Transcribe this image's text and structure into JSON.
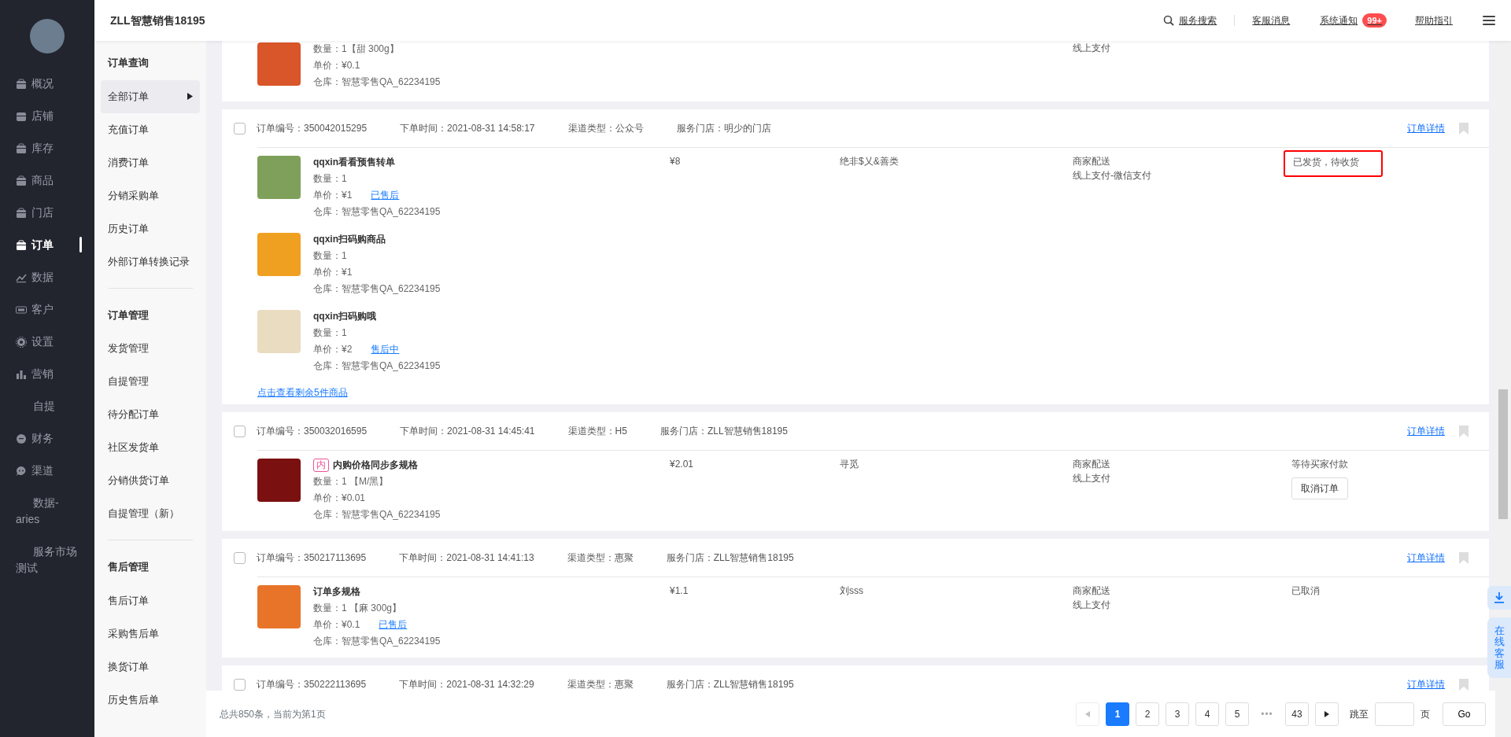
{
  "sidebar": {
    "items": [
      {
        "label": "概况",
        "has_icon": true,
        "selected": false
      },
      {
        "label": "店铺",
        "has_icon": true,
        "selected": false
      },
      {
        "label": "库存",
        "has_icon": true,
        "selected": false
      },
      {
        "label": "商品",
        "has_icon": true,
        "selected": false
      },
      {
        "label": "门店",
        "has_icon": true,
        "selected": false
      },
      {
        "label": "订单",
        "has_icon": true,
        "selected": true
      },
      {
        "label": "数据",
        "has_icon": true,
        "selected": false
      },
      {
        "label": "客户",
        "has_icon": true,
        "selected": false
      },
      {
        "label": "设置",
        "has_icon": true,
        "selected": false
      },
      {
        "label": "营销",
        "has_icon": true,
        "selected": false
      },
      {
        "label": "自提",
        "has_icon": false,
        "selected": false
      },
      {
        "label": "财务",
        "has_icon": true,
        "selected": false
      },
      {
        "label": "渠道",
        "has_icon": true,
        "selected": false
      },
      {
        "label": "数据-aries",
        "has_icon": false,
        "selected": false
      },
      {
        "label": "服务市场测试",
        "has_icon": false,
        "selected": false
      }
    ]
  },
  "header": {
    "title": "ZLL智慧销售18195",
    "search": "服务搜索",
    "service_messages": "客服消息",
    "notifications": {
      "label": "系统通知",
      "badge": "99+"
    },
    "help": "帮助指引"
  },
  "subnav": {
    "groups": [
      {
        "heading": "订单查询",
        "items": [
          {
            "label": "全部订单",
            "selected": true
          },
          {
            "label": "充值订单",
            "selected": false
          },
          {
            "label": "消费订单",
            "selected": false
          },
          {
            "label": "分销采购单",
            "selected": false
          },
          {
            "label": "历史订单",
            "selected": false
          },
          {
            "label": "外部订单转换记录",
            "selected": false
          }
        ]
      },
      {
        "heading": "订单管理",
        "items": [
          {
            "label": "发货管理",
            "selected": false
          },
          {
            "label": "自提管理",
            "selected": false
          },
          {
            "label": "待分配订单",
            "selected": false
          },
          {
            "label": "社区发货单",
            "selected": false
          },
          {
            "label": "分销供货订单",
            "selected": false
          },
          {
            "label": "自提管理（新）",
            "selected": false
          }
        ]
      },
      {
        "heading": "售后管理",
        "items": [
          {
            "label": "售后订单",
            "selected": false
          },
          {
            "label": "采购售后单",
            "selected": false
          },
          {
            "label": "换货订单",
            "selected": false
          },
          {
            "label": "历史售后单",
            "selected": false
          }
        ]
      }
    ]
  },
  "orders": [
    {
      "partial": true,
      "products": [
        {
          "qty": "数量：1【甜 300g】",
          "unit_price": "单价：¥0.1",
          "warehouse": "仓库：智慧零售QA_62234195"
        }
      ],
      "delivery": [
        "线上支付"
      ]
    },
    {
      "checked": false,
      "number": "订单编号：350042015295",
      "time": "下单时间：2021-08-31 14:58:17",
      "channel": "渠道类型：公众号",
      "store": "服务门店：明少的门店",
      "detail": "订单详情",
      "products": [
        {
          "name": "qqxin看看预售转单",
          "qty": "数量：1",
          "unit_price": "单价：¥1",
          "after_sale": "已售后",
          "warehouse": "仓库：智慧零售QA_62234195"
        },
        {
          "name": "qqxin扫码购商品",
          "qty": "数量：1",
          "unit_price": "单价：¥1",
          "warehouse": "仓库：智慧零售QA_62234195"
        },
        {
          "name": "qqxin扫码购哦",
          "qty": "数量：1",
          "unit_price": "单价：¥2",
          "after_sale": "售后中",
          "warehouse": "仓库：智慧零售QA_62234195"
        }
      ],
      "more": "点击查看剩余5件商品",
      "price": "¥8",
      "buyer": "绝非$乂&善类",
      "delivery": [
        "商家配送",
        "线上支付-微信支付"
      ],
      "status": "已发货，待收货",
      "highlighted": true
    },
    {
      "checked": false,
      "number": "订单编号：350032016595",
      "time": "下单时间：2021-08-31 14:45:41",
      "channel": "渠道类型：H5",
      "store": "服务门店：ZLL智慧销售18195",
      "detail": "订单详情",
      "products": [
        {
          "tag": "内",
          "name": "内购价格同步多规格",
          "qty": "数量：1 【M/黑】",
          "unit_price": "单价：¥0.01",
          "warehouse": "仓库：智慧零售QA_62234195"
        }
      ],
      "price": "¥2.01",
      "buyer": "寻觅",
      "delivery": [
        "商家配送",
        "线上支付"
      ],
      "status": "等待买家付款",
      "highlighted": false,
      "action": "取消订单"
    },
    {
      "checked": false,
      "number": "订单编号：350217113695",
      "time": "下单时间：2021-08-31 14:41:13",
      "channel": "渠道类型：惠聚",
      "store": "服务门店：ZLL智慧销售18195",
      "detail": "订单详情",
      "products": [
        {
          "name": "订单多规格",
          "qty": "数量：1 【麻 300g】",
          "unit_price": "单价：¥0.1",
          "after_sale": "已售后",
          "warehouse": "仓库：智慧零售QA_62234195"
        }
      ],
      "price": "¥1.1",
      "buyer": "刘sss",
      "delivery": [
        "商家配送",
        "线上支付"
      ],
      "status": "已取消",
      "highlighted": false
    },
    {
      "checked": false,
      "number": "订单编号：350222113695",
      "time": "下单时间：2021-08-31 14:32:29",
      "channel": "渠道类型：惠聚",
      "store": "服务门店：ZLL智慧销售18195",
      "detail": "订单详情"
    }
  ],
  "pagination": {
    "summary": "总共850条，当前为第1页",
    "prev_disabled": true,
    "pages": [
      {
        "label": "1",
        "selected": true
      },
      {
        "label": "2",
        "selected": false
      },
      {
        "label": "3",
        "selected": false
      },
      {
        "label": "4",
        "selected": false
      },
      {
        "label": "5",
        "selected": false
      },
      {
        "label": "43",
        "selected": false
      }
    ],
    "gap": "•••",
    "jump_label": "跳至",
    "page_unit": "页",
    "go": "Go"
  },
  "chat_widget": "在线客服"
}
